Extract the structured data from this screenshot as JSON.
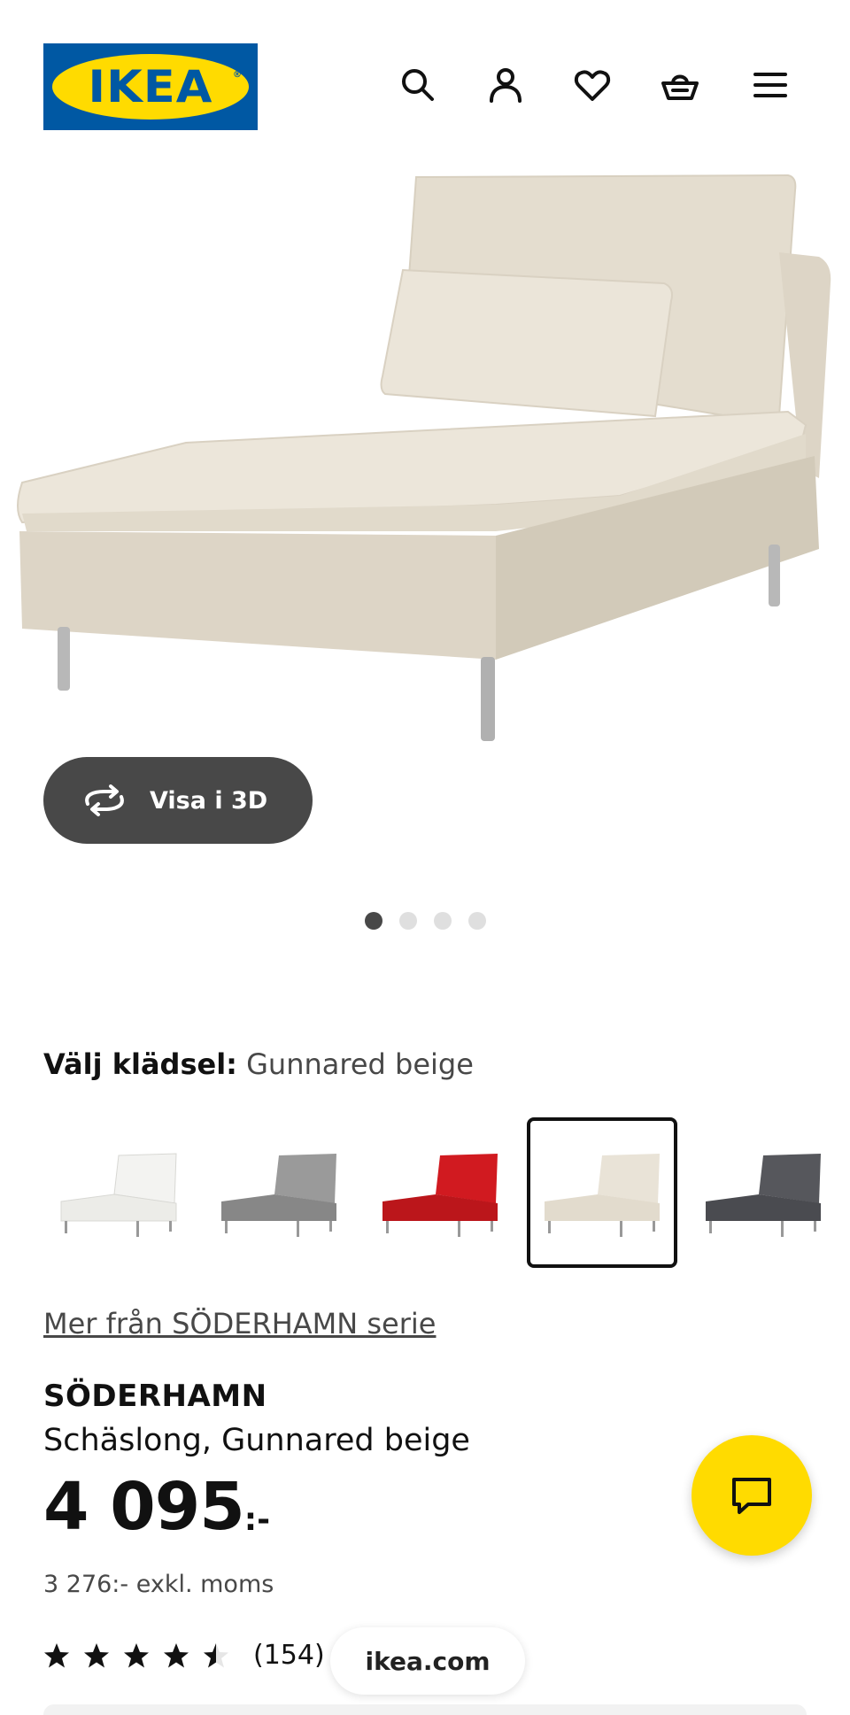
{
  "header": {
    "logo_text": "IKEA",
    "icons": [
      "search-icon",
      "account-icon",
      "heart-icon",
      "basket-icon",
      "menu-icon"
    ],
    "brand_colors": {
      "blue": "#0058a3",
      "yellow": "#ffdb00"
    }
  },
  "gallery": {
    "view_3d_label": "Visa i 3D",
    "slides": 4,
    "active_slide": 1
  },
  "upholstery": {
    "label": "Välj klädsel:",
    "value": "Gunnared beige",
    "options": [
      {
        "color": "#efefec",
        "selected": false
      },
      {
        "color": "#8f8f8f",
        "selected": false
      },
      {
        "color": "#c4171c",
        "selected": false
      },
      {
        "color": "#e7e1d4",
        "selected": true
      },
      {
        "color": "#4e4f54",
        "selected": false
      }
    ]
  },
  "product": {
    "series_link": "Mer från SÖDERHAMN serie",
    "name": "SÖDERHAMN",
    "description": "Schäslong, Gunnared beige",
    "price": "4 095",
    "price_suffix": ":-",
    "price_ex_vat": "3 276:- exkl. moms",
    "rating_value": 4.5,
    "rating_count": "(154)"
  },
  "browser": {
    "domain": "ikea.com"
  }
}
